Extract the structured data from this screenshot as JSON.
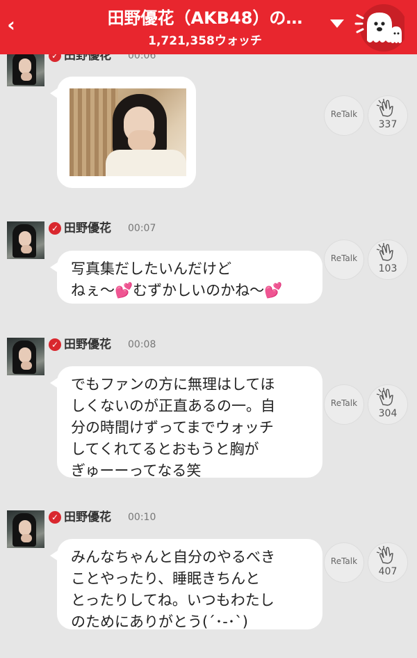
{
  "header": {
    "title": "田野優花（AKB48）の…",
    "watch_count": "1,721,358ウォッチ",
    "back_symbol": "‹",
    "accent": "#e8262e"
  },
  "icons": {
    "back": "chevron-left-icon",
    "dropdown": "triangle-down-icon",
    "mascot": "ghost-mascot-icon",
    "verified": "check-badge-icon",
    "clap": "clapping-hands-icon"
  },
  "messages": [
    {
      "name": "田野優花",
      "time": "00:06",
      "type": "photo",
      "lines": [],
      "retalk": "ReTalk",
      "claps": "337"
    },
    {
      "name": "田野優花",
      "time": "00:07",
      "type": "text",
      "lines": [
        "写真集だしたいんだけど",
        "ねぇ〜💕むずかしいのかね〜💕"
      ],
      "retalk": "ReTalk",
      "claps": "103"
    },
    {
      "name": "田野優花",
      "time": "00:08",
      "type": "text",
      "lines": [
        "でもファンの方に無理はしてほ",
        "しくないのが正直あるの一。自",
        "分の時間けずってまでウォッチ",
        "してくれてるとおもうと胸が",
        "ぎゅーーってなる笑"
      ],
      "retalk": "ReTalk",
      "claps": "304"
    },
    {
      "name": "田野優花",
      "time": "00:10",
      "type": "text",
      "lines": [
        "みんなちゃんと自分のやるべき",
        "ことやったり、睡眠きちんと",
        "とったりしてね。いつもわたし",
        "のためにありがとう(´･-･`)"
      ],
      "retalk": "ReTalk",
      "claps": "407"
    }
  ]
}
